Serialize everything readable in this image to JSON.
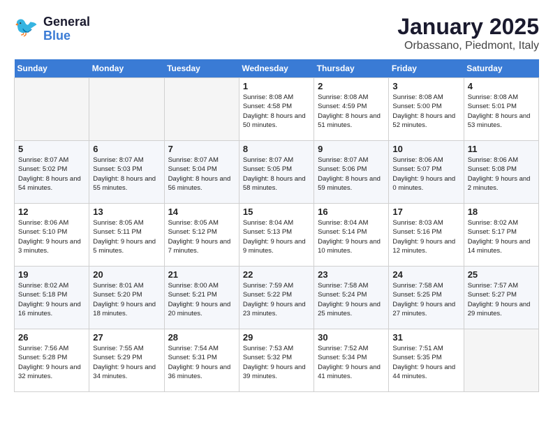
{
  "logo": {
    "text_general": "General",
    "text_blue": "Blue"
  },
  "title": "January 2025",
  "location": "Orbassano, Piedmont, Italy",
  "days_of_week": [
    "Sunday",
    "Monday",
    "Tuesday",
    "Wednesday",
    "Thursday",
    "Friday",
    "Saturday"
  ],
  "weeks": [
    [
      {
        "day": null,
        "empty": true
      },
      {
        "day": null,
        "empty": true
      },
      {
        "day": null,
        "empty": true
      },
      {
        "day": "1",
        "sunrise": "8:08 AM",
        "sunset": "4:58 PM",
        "daylight": "8 hours and 50 minutes."
      },
      {
        "day": "2",
        "sunrise": "8:08 AM",
        "sunset": "4:59 PM",
        "daylight": "8 hours and 51 minutes."
      },
      {
        "day": "3",
        "sunrise": "8:08 AM",
        "sunset": "5:00 PM",
        "daylight": "8 hours and 52 minutes."
      },
      {
        "day": "4",
        "sunrise": "8:08 AM",
        "sunset": "5:01 PM",
        "daylight": "8 hours and 53 minutes."
      }
    ],
    [
      {
        "day": "5",
        "sunrise": "8:07 AM",
        "sunset": "5:02 PM",
        "daylight": "8 hours and 54 minutes."
      },
      {
        "day": "6",
        "sunrise": "8:07 AM",
        "sunset": "5:03 PM",
        "daylight": "8 hours and 55 minutes."
      },
      {
        "day": "7",
        "sunrise": "8:07 AM",
        "sunset": "5:04 PM",
        "daylight": "8 hours and 56 minutes."
      },
      {
        "day": "8",
        "sunrise": "8:07 AM",
        "sunset": "5:05 PM",
        "daylight": "8 hours and 58 minutes."
      },
      {
        "day": "9",
        "sunrise": "8:07 AM",
        "sunset": "5:06 PM",
        "daylight": "8 hours and 59 minutes."
      },
      {
        "day": "10",
        "sunrise": "8:06 AM",
        "sunset": "5:07 PM",
        "daylight": "9 hours and 0 minutes."
      },
      {
        "day": "11",
        "sunrise": "8:06 AM",
        "sunset": "5:08 PM",
        "daylight": "9 hours and 2 minutes."
      }
    ],
    [
      {
        "day": "12",
        "sunrise": "8:06 AM",
        "sunset": "5:10 PM",
        "daylight": "9 hours and 3 minutes."
      },
      {
        "day": "13",
        "sunrise": "8:05 AM",
        "sunset": "5:11 PM",
        "daylight": "9 hours and 5 minutes."
      },
      {
        "day": "14",
        "sunrise": "8:05 AM",
        "sunset": "5:12 PM",
        "daylight": "9 hours and 7 minutes."
      },
      {
        "day": "15",
        "sunrise": "8:04 AM",
        "sunset": "5:13 PM",
        "daylight": "9 hours and 9 minutes."
      },
      {
        "day": "16",
        "sunrise": "8:04 AM",
        "sunset": "5:14 PM",
        "daylight": "9 hours and 10 minutes."
      },
      {
        "day": "17",
        "sunrise": "8:03 AM",
        "sunset": "5:16 PM",
        "daylight": "9 hours and 12 minutes."
      },
      {
        "day": "18",
        "sunrise": "8:02 AM",
        "sunset": "5:17 PM",
        "daylight": "9 hours and 14 minutes."
      }
    ],
    [
      {
        "day": "19",
        "sunrise": "8:02 AM",
        "sunset": "5:18 PM",
        "daylight": "9 hours and 16 minutes."
      },
      {
        "day": "20",
        "sunrise": "8:01 AM",
        "sunset": "5:20 PM",
        "daylight": "9 hours and 18 minutes."
      },
      {
        "day": "21",
        "sunrise": "8:00 AM",
        "sunset": "5:21 PM",
        "daylight": "9 hours and 20 minutes."
      },
      {
        "day": "22",
        "sunrise": "7:59 AM",
        "sunset": "5:22 PM",
        "daylight": "9 hours and 23 minutes."
      },
      {
        "day": "23",
        "sunrise": "7:58 AM",
        "sunset": "5:24 PM",
        "daylight": "9 hours and 25 minutes."
      },
      {
        "day": "24",
        "sunrise": "7:58 AM",
        "sunset": "5:25 PM",
        "daylight": "9 hours and 27 minutes."
      },
      {
        "day": "25",
        "sunrise": "7:57 AM",
        "sunset": "5:27 PM",
        "daylight": "9 hours and 29 minutes."
      }
    ],
    [
      {
        "day": "26",
        "sunrise": "7:56 AM",
        "sunset": "5:28 PM",
        "daylight": "9 hours and 32 minutes."
      },
      {
        "day": "27",
        "sunrise": "7:55 AM",
        "sunset": "5:29 PM",
        "daylight": "9 hours and 34 minutes."
      },
      {
        "day": "28",
        "sunrise": "7:54 AM",
        "sunset": "5:31 PM",
        "daylight": "9 hours and 36 minutes."
      },
      {
        "day": "29",
        "sunrise": "7:53 AM",
        "sunset": "5:32 PM",
        "daylight": "9 hours and 39 minutes."
      },
      {
        "day": "30",
        "sunrise": "7:52 AM",
        "sunset": "5:34 PM",
        "daylight": "9 hours and 41 minutes."
      },
      {
        "day": "31",
        "sunrise": "7:51 AM",
        "sunset": "5:35 PM",
        "daylight": "9 hours and 44 minutes."
      },
      {
        "day": null,
        "empty": true
      }
    ]
  ],
  "labels": {
    "sunrise": "Sunrise:",
    "sunset": "Sunset:",
    "daylight": "Daylight:"
  }
}
